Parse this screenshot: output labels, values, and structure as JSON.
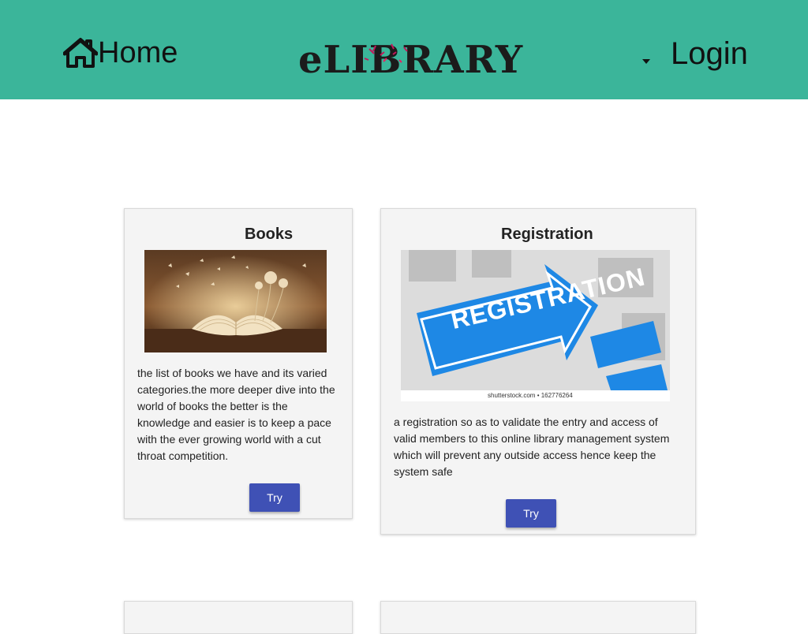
{
  "nav": {
    "home_label": "Home",
    "login_label": "Login",
    "logo_text": "eLIBRARY",
    "home_icon": "home-icon",
    "dropdown_icon": "caret-down-icon"
  },
  "colors": {
    "header_bg": "#3bb59a",
    "button_bg": "#3f51b5",
    "card_bg": "#f4f4f4"
  },
  "cards": [
    {
      "title": "Books",
      "image": "open-book-with-butterflies",
      "description": "the list of books we have and its varied categories.the more deeper dive into the world of books the better is the knowledge and easier is to keep a pace with the ever growing world with a cut throat competition.",
      "button_label": "Try"
    },
    {
      "title": "Registration",
      "image": "registration-arrow-sign",
      "image_text": "REGISTRATION",
      "image_caption": "shutterstock.com • 162776264",
      "description": "a registration so as to validate the entry and access of valid members to this online library management system which will prevent any outside access hence keep the system safe",
      "button_label": "Try"
    }
  ]
}
